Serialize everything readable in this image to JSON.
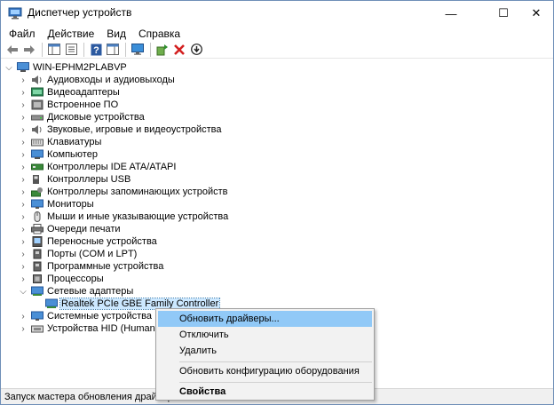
{
  "window": {
    "title": "Диспетчер устройств",
    "minimize_glyph": "—",
    "maximize_glyph": "☐",
    "close_glyph": "✕"
  },
  "menu": [
    "Файл",
    "Действие",
    "Вид",
    "Справка"
  ],
  "toolbar": [
    "back-arrow-icon",
    "forward-arrow-icon",
    "console-tree-icon",
    "properties-icon",
    "help-icon",
    "action-pane-icon",
    "monitor-scan-icon",
    "add-driver-icon",
    "remove-device-icon",
    "update-driver-icon"
  ],
  "tree": {
    "root": "WIN-EPHM2PLABVP",
    "items": [
      {
        "label": "Аудиовходы и аудиовыходы",
        "icon": "speaker-icon"
      },
      {
        "label": "Видеоадаптеры",
        "icon": "display-adapter-icon"
      },
      {
        "label": "Встроенное ПО",
        "icon": "firmware-icon"
      },
      {
        "label": "Дисковые устройства",
        "icon": "disk-drive-icon"
      },
      {
        "label": "Звуковые, игровые и видеоустройства",
        "icon": "sound-icon"
      },
      {
        "label": "Клавиатуры",
        "icon": "keyboard-icon"
      },
      {
        "label": "Компьютер",
        "icon": "computer-icon"
      },
      {
        "label": "Контроллеры IDE ATA/ATAPI",
        "icon": "ide-controller-icon"
      },
      {
        "label": "Контроллеры USB",
        "icon": "usb-icon"
      },
      {
        "label": "Контроллеры запоминающих устройств",
        "icon": "storage-controller-icon"
      },
      {
        "label": "Мониторы",
        "icon": "monitor-icon"
      },
      {
        "label": "Мыши и иные указывающие устройства",
        "icon": "mouse-icon"
      },
      {
        "label": "Очереди печати",
        "icon": "printer-icon"
      },
      {
        "label": "Переносные устройства",
        "icon": "portable-device-icon"
      },
      {
        "label": "Порты (COM и LPT)",
        "icon": "port-icon"
      },
      {
        "label": "Программные устройства",
        "icon": "software-device-icon"
      },
      {
        "label": "Процессоры",
        "icon": "processor-icon"
      },
      {
        "label": "Сетевые адаптеры",
        "icon": "network-adapter-icon"
      },
      {
        "label": "Realtek PCIe GBE Family Controller",
        "icon": "network-card-icon"
      },
      {
        "label": "Системные устройства",
        "icon": "system-device-icon"
      },
      {
        "label": "Устройства HID (Human Inte",
        "icon": "hid-icon"
      }
    ]
  },
  "context_menu": {
    "update_drivers": "Обновить драйверы...",
    "disable": "Отключить",
    "delete": "Удалить",
    "scan_hardware": "Обновить конфигурацию оборудования",
    "properties": "Свойства"
  },
  "status": "Запуск мастера обновления драйверов"
}
